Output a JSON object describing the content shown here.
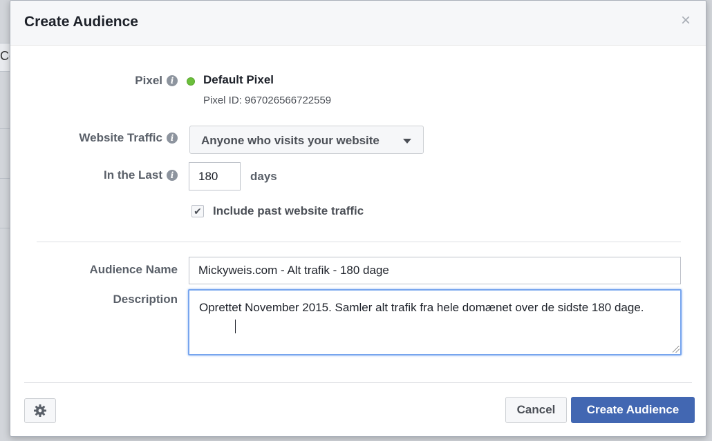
{
  "backdrop": {
    "fragment_text": "Co"
  },
  "dialog": {
    "title": "Create Audience",
    "close_symbol": "×"
  },
  "pixel": {
    "label": "Pixel",
    "name": "Default Pixel",
    "status_color": "#6bbf3b",
    "id_text": "Pixel ID: 967026566722559"
  },
  "website_traffic": {
    "label": "Website Traffic",
    "selected": "Anyone who visits your website"
  },
  "in_the_last": {
    "label": "In the Last",
    "value": "180",
    "unit": "days"
  },
  "past_traffic": {
    "checked": true,
    "label": "Include past website traffic"
  },
  "audience_name": {
    "label": "Audience Name",
    "value": "Mickyweis.com - Alt trafik - 180 dage"
  },
  "description": {
    "label": "Description",
    "value": "Oprettet November 2015. Samler alt trafik fra hele domænet over de sidste 180 dage."
  },
  "footer": {
    "cancel_label": "Cancel",
    "create_label": "Create Audience"
  },
  "colors": {
    "primary": "#4267b2",
    "focus_border": "#77a5ee"
  }
}
